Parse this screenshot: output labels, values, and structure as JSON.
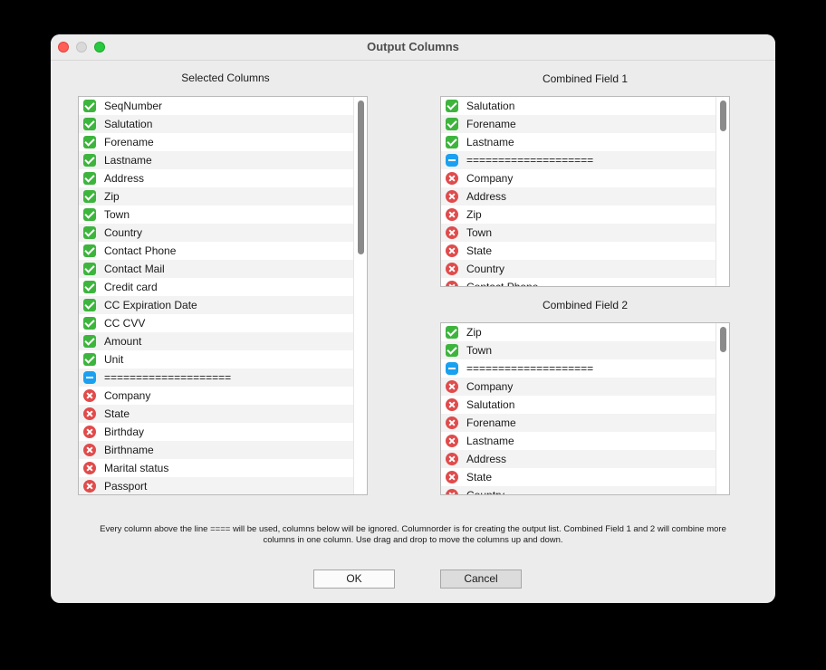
{
  "window": {
    "title": "Output Columns"
  },
  "selected": {
    "header": "Selected Columns",
    "items": [
      {
        "label": "SeqNumber",
        "status": "check"
      },
      {
        "label": "Salutation",
        "status": "check"
      },
      {
        "label": "Forename",
        "status": "check"
      },
      {
        "label": "Lastname",
        "status": "check"
      },
      {
        "label": "Address",
        "status": "check"
      },
      {
        "label": "Zip",
        "status": "check"
      },
      {
        "label": "Town",
        "status": "check"
      },
      {
        "label": "Country",
        "status": "check"
      },
      {
        "label": "Contact Phone",
        "status": "check"
      },
      {
        "label": "Contact Mail",
        "status": "check"
      },
      {
        "label": "Credit card",
        "status": "check"
      },
      {
        "label": "CC Expiration Date",
        "status": "check"
      },
      {
        "label": "CC CVV",
        "status": "check"
      },
      {
        "label": "Amount",
        "status": "check"
      },
      {
        "label": "Unit",
        "status": "check"
      },
      {
        "label": "====================",
        "status": "minus"
      },
      {
        "label": "Company",
        "status": "cross"
      },
      {
        "label": "State",
        "status": "cross"
      },
      {
        "label": "Birthday",
        "status": "cross"
      },
      {
        "label": "Birthname",
        "status": "cross"
      },
      {
        "label": "Marital status",
        "status": "cross"
      },
      {
        "label": "Passport",
        "status": "cross"
      }
    ]
  },
  "combined1": {
    "header": "Combined Field 1",
    "items": [
      {
        "label": "Salutation",
        "status": "check"
      },
      {
        "label": "Forename",
        "status": "check"
      },
      {
        "label": "Lastname",
        "status": "check"
      },
      {
        "label": "====================",
        "status": "minus"
      },
      {
        "label": "Company",
        "status": "cross"
      },
      {
        "label": "Address",
        "status": "cross"
      },
      {
        "label": "Zip",
        "status": "cross"
      },
      {
        "label": "Town",
        "status": "cross"
      },
      {
        "label": "State",
        "status": "cross"
      },
      {
        "label": "Country",
        "status": "cross"
      },
      {
        "label": "Contact Phone",
        "status": "cross"
      }
    ]
  },
  "combined2": {
    "header": "Combined Field 2",
    "items": [
      {
        "label": "Zip",
        "status": "check"
      },
      {
        "label": "Town",
        "status": "check"
      },
      {
        "label": "====================",
        "status": "minus"
      },
      {
        "label": "Company",
        "status": "cross"
      },
      {
        "label": "Salutation",
        "status": "cross"
      },
      {
        "label": "Forename",
        "status": "cross"
      },
      {
        "label": "Lastname",
        "status": "cross"
      },
      {
        "label": "Address",
        "status": "cross"
      },
      {
        "label": "State",
        "status": "cross"
      },
      {
        "label": "Country",
        "status": "cross"
      }
    ]
  },
  "info_text": "Every column above the line ==== will be used, columns below will be ignored. Columnorder is for creating the output list. Combined Field 1 and 2 will combine more columns in one column. Use drag and drop to move the columns up and down.",
  "buttons": {
    "ok": "OK",
    "cancel": "Cancel"
  },
  "icons": {
    "check": "checkmark-icon",
    "minus": "separator-icon",
    "cross": "excluded-icon"
  },
  "colors": {
    "check": "#3db53d",
    "minus": "#1aa0f0",
    "cross": "#e04b4b"
  }
}
